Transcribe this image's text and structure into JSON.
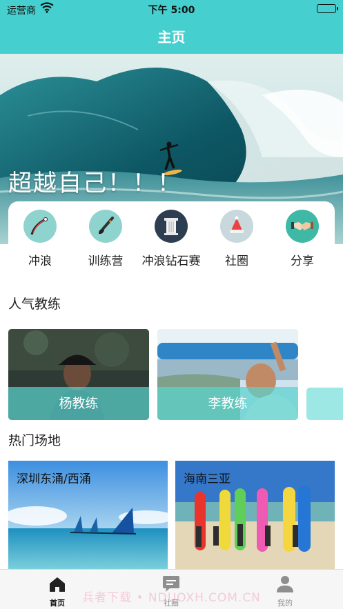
{
  "status_bar": {
    "carrier": "运营商",
    "time": "下午 5:00"
  },
  "nav": {
    "title": "主页"
  },
  "banner": {
    "slogan": "超越自己！！！"
  },
  "categories": [
    {
      "label": "冲浪",
      "icon": "surfboard-icon"
    },
    {
      "label": "训练营",
      "icon": "brush-icon"
    },
    {
      "label": "冲浪钻石赛",
      "icon": "pillar-icon"
    },
    {
      "label": "社圈",
      "icon": "santa-hat-icon"
    },
    {
      "label": "分享",
      "icon": "handshake-icon"
    }
  ],
  "popular_coaches": {
    "title": "人气教练",
    "items": [
      {
        "name": "杨教练"
      },
      {
        "name": "李教练"
      }
    ]
  },
  "hot_venues": {
    "title": "热门场地",
    "items": [
      {
        "name": "深圳东涌/西涌"
      },
      {
        "name": "海南三亚"
      }
    ]
  },
  "tab_bar": {
    "items": [
      {
        "label": "首页",
        "icon": "home-icon",
        "active": true
      },
      {
        "label": "社圈",
        "icon": "chat-icon",
        "active": false
      },
      {
        "label": "我的",
        "icon": "person-icon",
        "active": false
      }
    ],
    "watermark": "兵者下载 • NDUOXH.COM.CN"
  },
  "colors": {
    "accent": "#46cfcf",
    "coach_label_bg": "#5ad2cd"
  }
}
